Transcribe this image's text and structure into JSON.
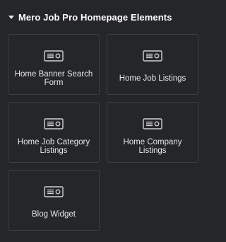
{
  "section": {
    "title": "Mero Job Pro Homepage Elements"
  },
  "widgets": [
    {
      "label": "Home Banner Search Form",
      "icon": "form-icon"
    },
    {
      "label": "Home Job Listings",
      "icon": "form-icon"
    },
    {
      "label": "Home Job Category Listings",
      "icon": "form-icon"
    },
    {
      "label": "Home Company Listings",
      "icon": "form-icon"
    },
    {
      "label": "Blog Widget",
      "icon": "form-icon"
    }
  ],
  "colors": {
    "background": "#252629",
    "card_border": "#3d3e42",
    "text": "#e6e6e6",
    "icon": "#d0d0d0"
  }
}
